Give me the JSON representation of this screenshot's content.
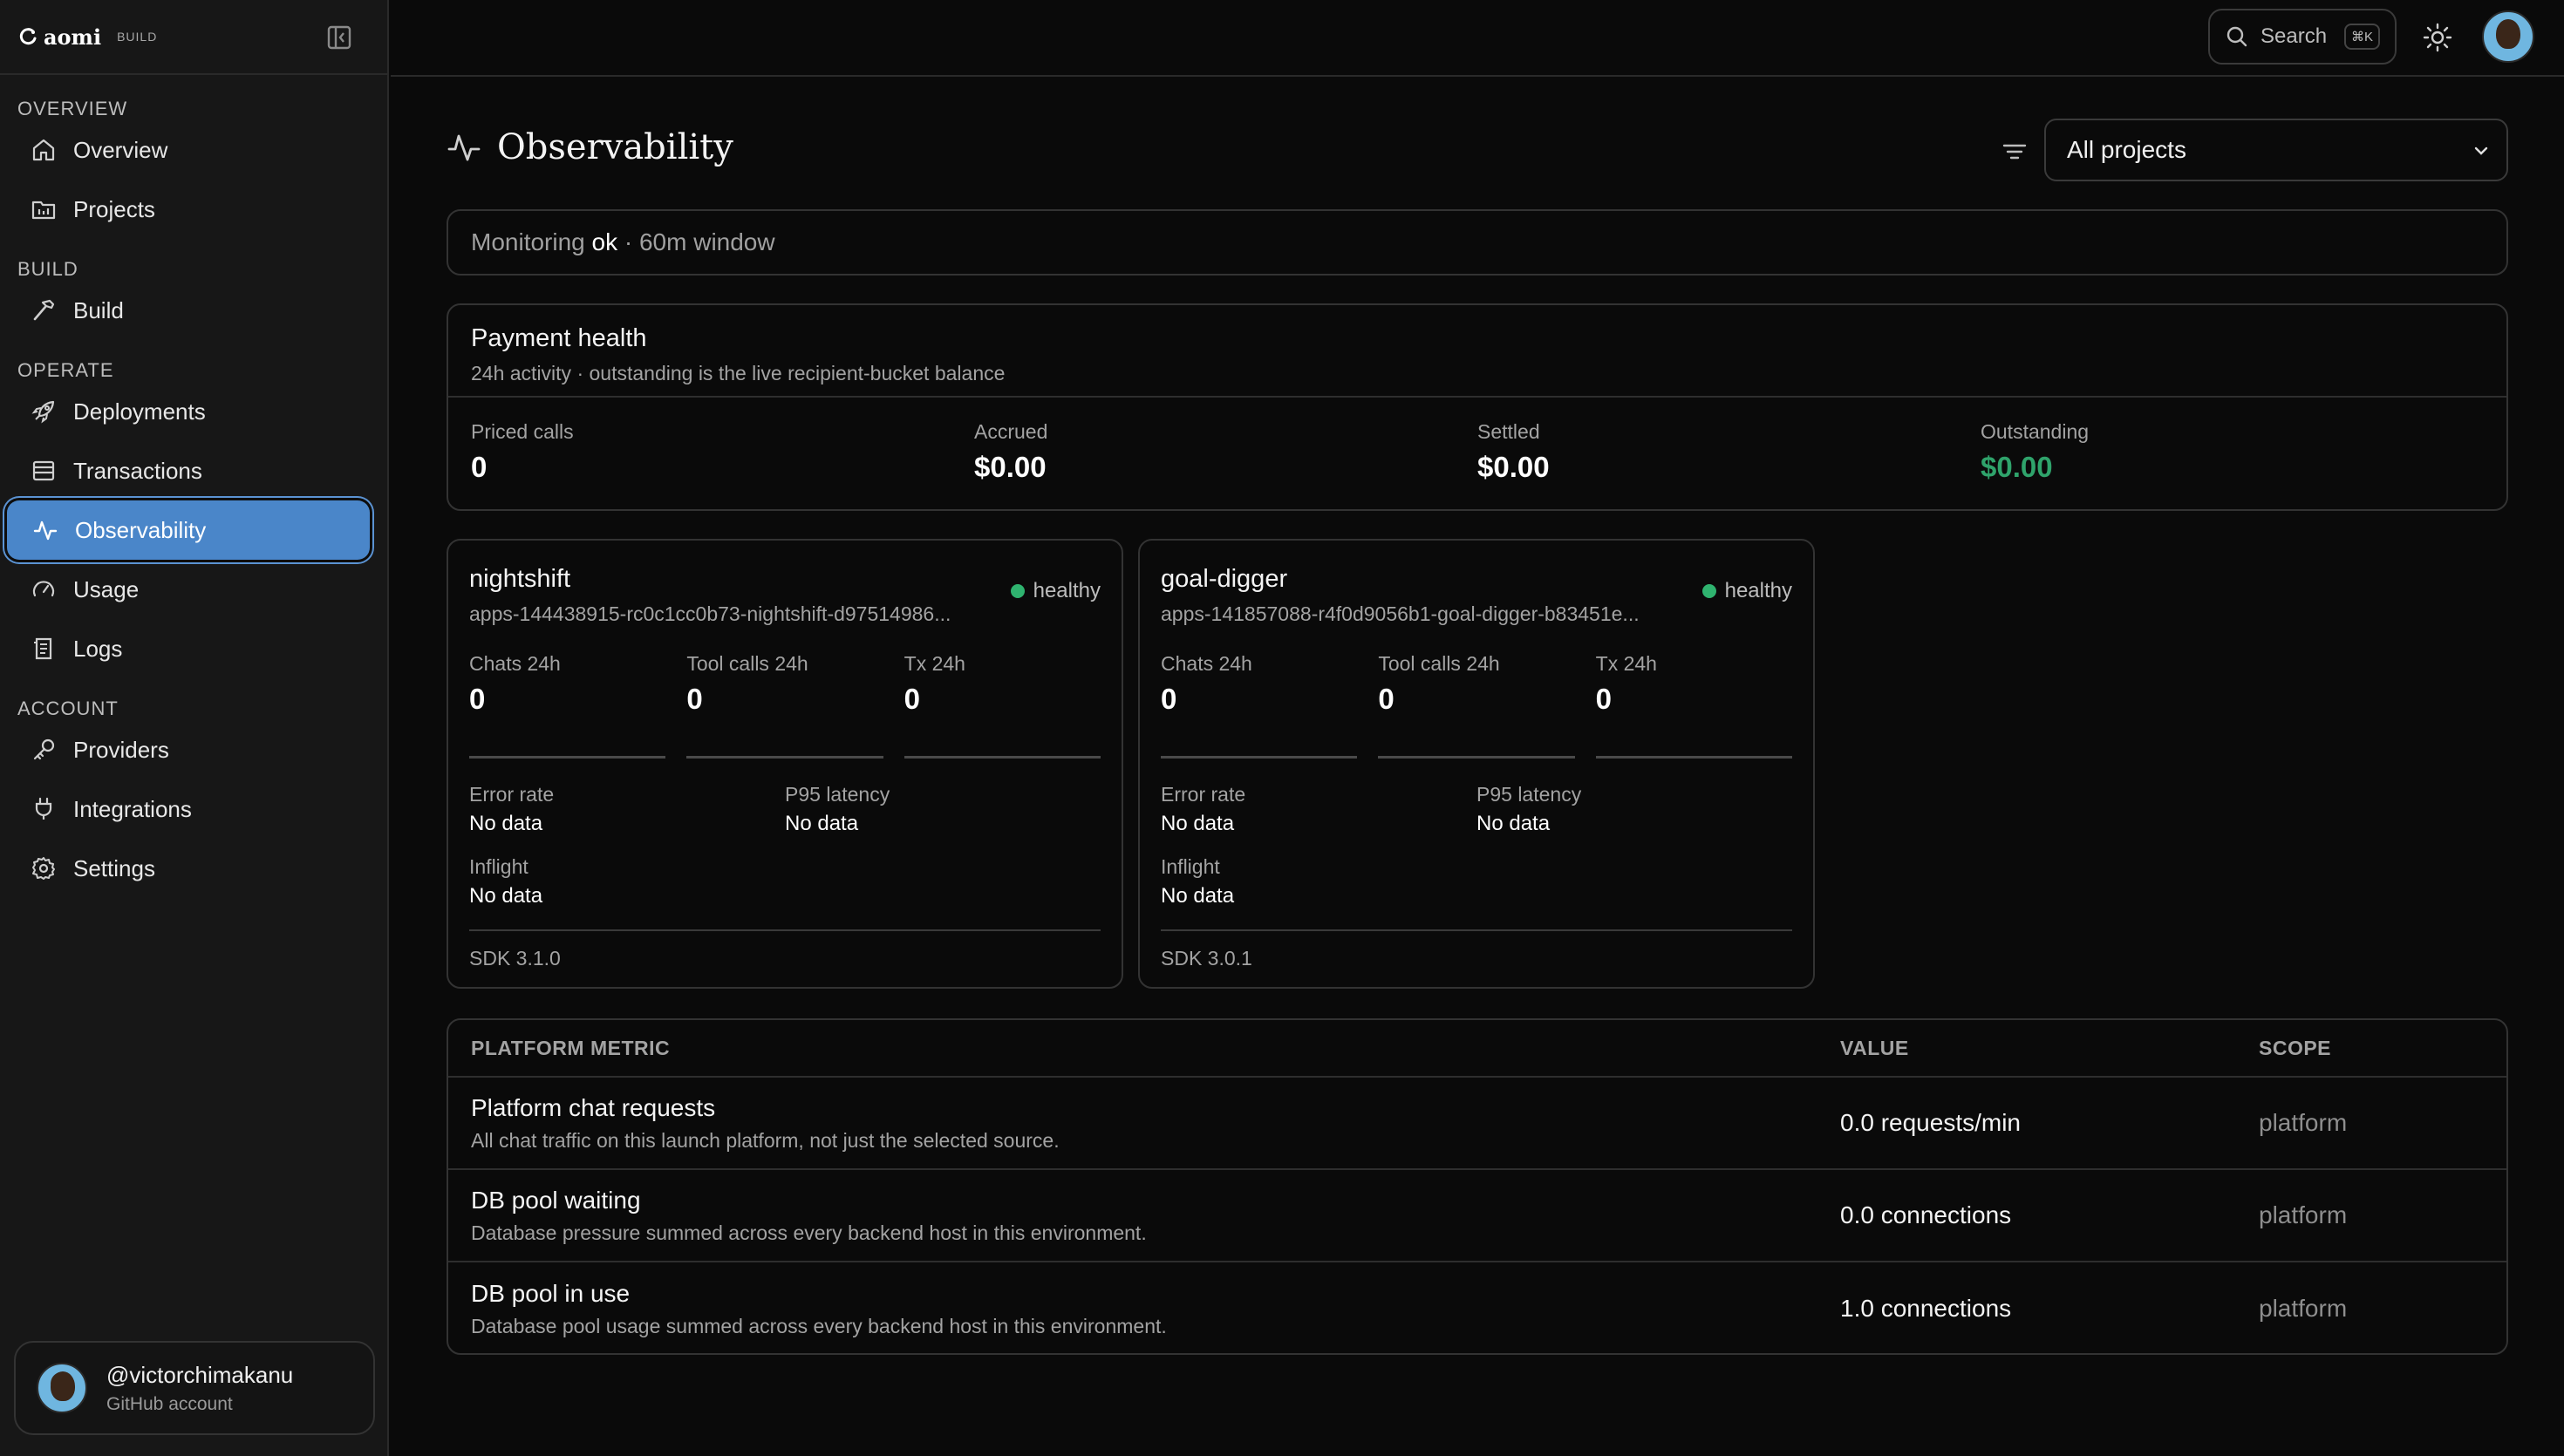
{
  "brand": {
    "name": "aomi",
    "badge": "BUILD"
  },
  "sidebar": {
    "sections": [
      {
        "heading": "OVERVIEW",
        "items": [
          {
            "label": "Overview",
            "icon": "home-icon"
          },
          {
            "label": "Projects",
            "icon": "projects-icon"
          }
        ]
      },
      {
        "heading": "BUILD",
        "items": [
          {
            "label": "Build",
            "icon": "hammer-icon"
          }
        ]
      },
      {
        "heading": "OPERATE",
        "items": [
          {
            "label": "Deployments",
            "icon": "rocket-icon"
          },
          {
            "label": "Transactions",
            "icon": "receipt-icon"
          },
          {
            "label": "Observability",
            "icon": "activity-icon",
            "active": true
          },
          {
            "label": "Usage",
            "icon": "gauge-icon"
          },
          {
            "label": "Logs",
            "icon": "logs-icon"
          }
        ]
      },
      {
        "heading": "ACCOUNT",
        "items": [
          {
            "label": "Providers",
            "icon": "key-icon"
          },
          {
            "label": "Integrations",
            "icon": "plug-icon"
          },
          {
            "label": "Settings",
            "icon": "gear-icon"
          }
        ]
      }
    ],
    "account": {
      "handle": "@victorchimakanu",
      "sub": "GitHub account"
    }
  },
  "topbar": {
    "search_label": "Search",
    "shortcut": "⌘K"
  },
  "page": {
    "title": "Observability",
    "project_filter": "All projects",
    "monitoring": {
      "prefix": "Monitoring ",
      "status": "ok",
      "suffix": " · 60m window"
    }
  },
  "payment": {
    "title": "Payment health",
    "subtitle": "24h activity · outstanding is the live recipient-bucket balance",
    "stats": [
      {
        "label": "Priced calls",
        "value": "0"
      },
      {
        "label": "Accrued",
        "value": "$0.00"
      },
      {
        "label": "Settled",
        "value": "$0.00"
      },
      {
        "label": "Outstanding",
        "value": "$0.00",
        "color": "#2fa36b"
      }
    ]
  },
  "apps": [
    {
      "name": "nightshift",
      "id": "apps-144438915-rc0c1cc0b73-nightshift-d97514986...",
      "status": "healthy",
      "metrics": [
        {
          "label": "Chats 24h",
          "value": "0"
        },
        {
          "label": "Tool calls 24h",
          "value": "0"
        },
        {
          "label": "Tx 24h",
          "value": "0"
        }
      ],
      "error_rate_label": "Error rate",
      "error_rate": "No data",
      "p95_label": "P95 latency",
      "p95": "No data",
      "inflight_label": "Inflight",
      "inflight": "No data",
      "sdk": "SDK 3.1.0"
    },
    {
      "name": "goal-digger",
      "id": "apps-141857088-r4f0d9056b1-goal-digger-b83451e...",
      "status": "healthy",
      "metrics": [
        {
          "label": "Chats 24h",
          "value": "0"
        },
        {
          "label": "Tool calls 24h",
          "value": "0"
        },
        {
          "label": "Tx 24h",
          "value": "0"
        }
      ],
      "error_rate_label": "Error rate",
      "error_rate": "No data",
      "p95_label": "P95 latency",
      "p95": "No data",
      "inflight_label": "Inflight",
      "inflight": "No data",
      "sdk": "SDK 3.0.1"
    }
  ],
  "platform_table": {
    "headers": [
      "PLATFORM METRIC",
      "VALUE",
      "SCOPE"
    ],
    "rows": [
      {
        "name": "Platform chat requests",
        "desc": "All chat traffic on this launch platform, not just the selected source.",
        "value": "0.0 requests/min",
        "scope": "platform"
      },
      {
        "name": "DB pool waiting",
        "desc": "Database pressure summed across every backend host in this environment.",
        "value": "0.0 connections",
        "scope": "platform"
      },
      {
        "name": "DB pool in use",
        "desc": "Database pool usage summed across every backend host in this environment.",
        "value": "1.0 connections",
        "scope": "platform"
      }
    ]
  },
  "colors": {
    "accent": "#4a86c9",
    "healthy": "#2fb36f",
    "outstanding": "#2fa36b"
  }
}
